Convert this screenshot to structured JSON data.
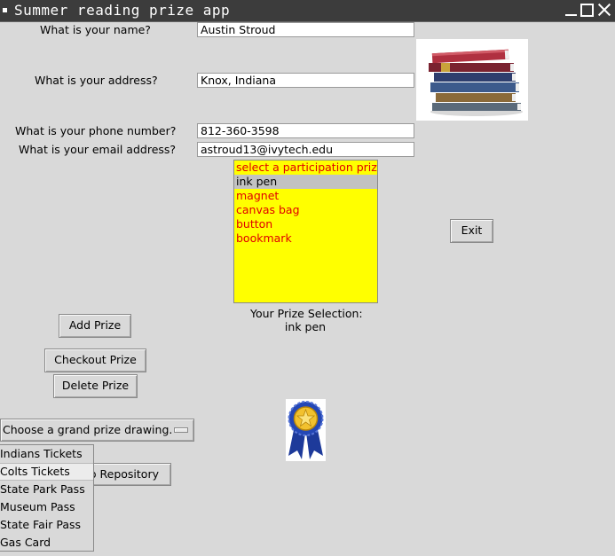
{
  "window": {
    "title": "Summer reading prize app"
  },
  "form": {
    "name_label": "What is your name?",
    "name_value": "Austin Stroud",
    "address_label": "What is your address?",
    "address_value": "Knox, Indiana",
    "phone_label": "What is your phone number?",
    "phone_value": "812-360-3598",
    "email_label": "What is your email address?",
    "email_value": "astroud13@ivytech.edu"
  },
  "prizes": {
    "items": [
      "select a participation prize",
      "ink pen",
      "magnet",
      "canvas bag",
      "button",
      "bookmark"
    ],
    "selected_index": 1,
    "colors": {
      "list_bg": "#ffff00",
      "item_text": "#e00000",
      "selected_bg": "#c2c2c2"
    }
  },
  "selection": {
    "caption": "Your Prize Selection:",
    "value": "ink pen"
  },
  "buttons": {
    "exit": "Exit",
    "add": "Add Prize",
    "checkout": "Checkout Prize",
    "delete": "Delete Prize",
    "repository_partial": "b Repository"
  },
  "grand_prize": {
    "selected": "Choose a grand prize drawing.",
    "options": [
      "Indians Tickets",
      "Colts Tickets",
      "State Park Pass",
      "Museum Pass",
      "State Fair Pass",
      "Gas Card"
    ],
    "highlighted_index": 1
  },
  "icons": {
    "books": "books-image",
    "award": "award-ribbon-icon"
  }
}
